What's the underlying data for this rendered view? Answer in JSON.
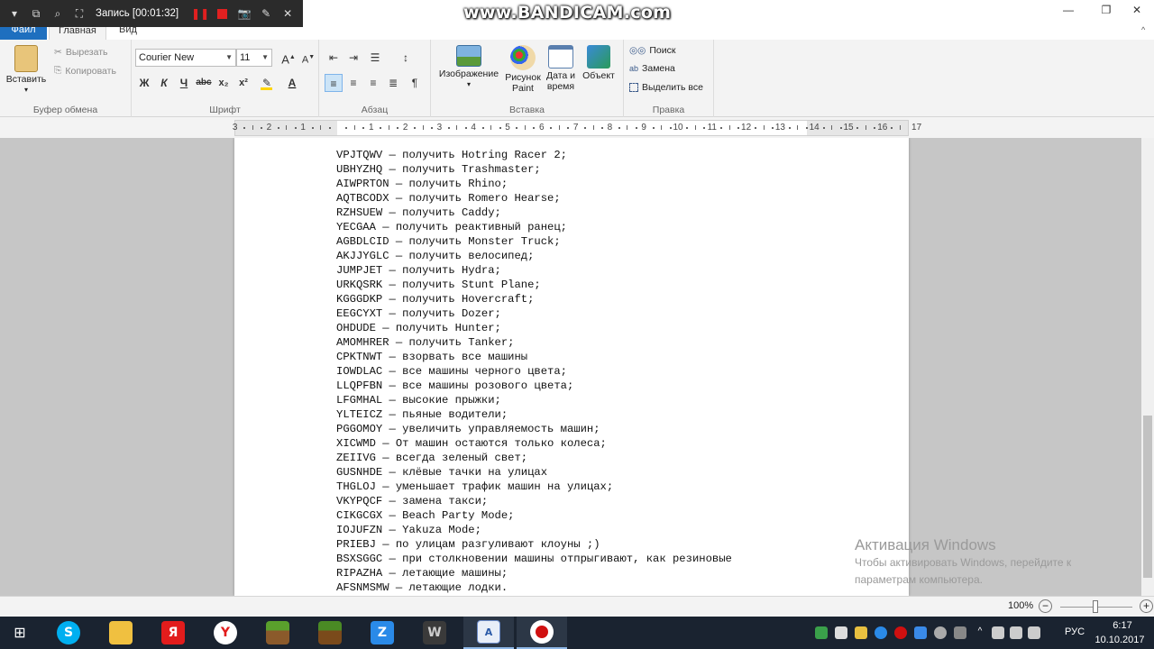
{
  "bandicam": {
    "record_label": "Запись [00:01:32]",
    "watermark": "www.BANDICAM.com"
  },
  "tabs": {
    "file": "Файл",
    "home": "Главная",
    "view": "Вид"
  },
  "ribbon": {
    "clipboard": {
      "paste": "Вставить",
      "cut": "Вырезать",
      "copy": "Копировать",
      "label": "Буфер обмена"
    },
    "font": {
      "family": "Courier New",
      "size": "11",
      "label": "Шрифт",
      "bold": "Ж",
      "italic": "К",
      "underline": "Ч",
      "strike": "abc",
      "subscript": "x₂",
      "superscript": "x²"
    },
    "paragraph": {
      "label": "Абзац"
    },
    "insert": {
      "image": "Изображение",
      "paint": "Рисунок Paint",
      "datetime": "Дата и время",
      "object": "Объект",
      "label": "Вставка"
    },
    "editing": {
      "find": "Поиск",
      "replace": "Замена",
      "select_all": "Выделить все",
      "label": "Правка"
    }
  },
  "ruler": {
    "labels": [
      "3",
      "2",
      "1",
      "1",
      "2",
      "3",
      "4",
      "5",
      "6",
      "7",
      "8",
      "9",
      "10",
      "11",
      "12",
      "13",
      "14",
      "15",
      "16",
      "17"
    ]
  },
  "document": {
    "lines": [
      "VPJTQWV — получить Hotring Racer 2;",
      "UBHYZHQ — получить Trashmaster;",
      "AIWPRTON — получить Rhino;",
      "AQTBCODX — получить Romero Hearse;",
      "RZHSUEW — получить Caddy;",
      "YECGAA — получить реактивный ранец;",
      "AGBDLCID — получить Monster Truck;",
      "AKJJYGLC — получить велосипед;",
      "JUMPJET — получить Hydra;",
      "URKQSRK — получить Stunt Plane;",
      "KGGGDKP — получить Hovercraft;",
      "EEGCYXT — получить Dozer;",
      "OHDUDE — получить Hunter;",
      "AMOMHRER — получить Tanker;",
      "CPKTNWT — взорвать все машины",
      "IOWDLAC — все машины черного цвета;",
      "LLQPFBN — все машины розового цвета;",
      "LFGMHAL — высокие прыжки;",
      "YLTEICZ — пьяные водители;",
      "PGGOMOY — увеличить управляемость машин;",
      "XICWMD — От машин остаются только колеса;",
      "ZEIIVG — всегда зеленый свет;",
      "GUSNHDE — клёвые тачки на улицах",
      "THGLOJ — уменьшает трафик машин на улицах;",
      "VKYPQCF — замена такси;",
      "CIKGCGX — Beach Party Mode;",
      "IOJUFZN — Yakuza Mode;",
      "PRIEBJ — по улицам разгуливают клоуны ;)",
      "BSXSGGC — при столкновении машины отпрыгивают, как резиновые",
      "RIPAZHA — летающие машины;",
      "AFSNMSMW — летающие лодки."
    ]
  },
  "activation": {
    "title": "Активация Windows",
    "subtitle": "Чтобы активировать Windows, перейдите к параметрам компьютера."
  },
  "status": {
    "zoom": "100%"
  },
  "taskbar": {
    "lang": "РУС",
    "time": "6:17",
    "date": "10.10.2017"
  },
  "colors": {
    "accent": "#1e6fbf",
    "taskbar": "#1a2330",
    "doc_bg": "#c6c6c6"
  }
}
